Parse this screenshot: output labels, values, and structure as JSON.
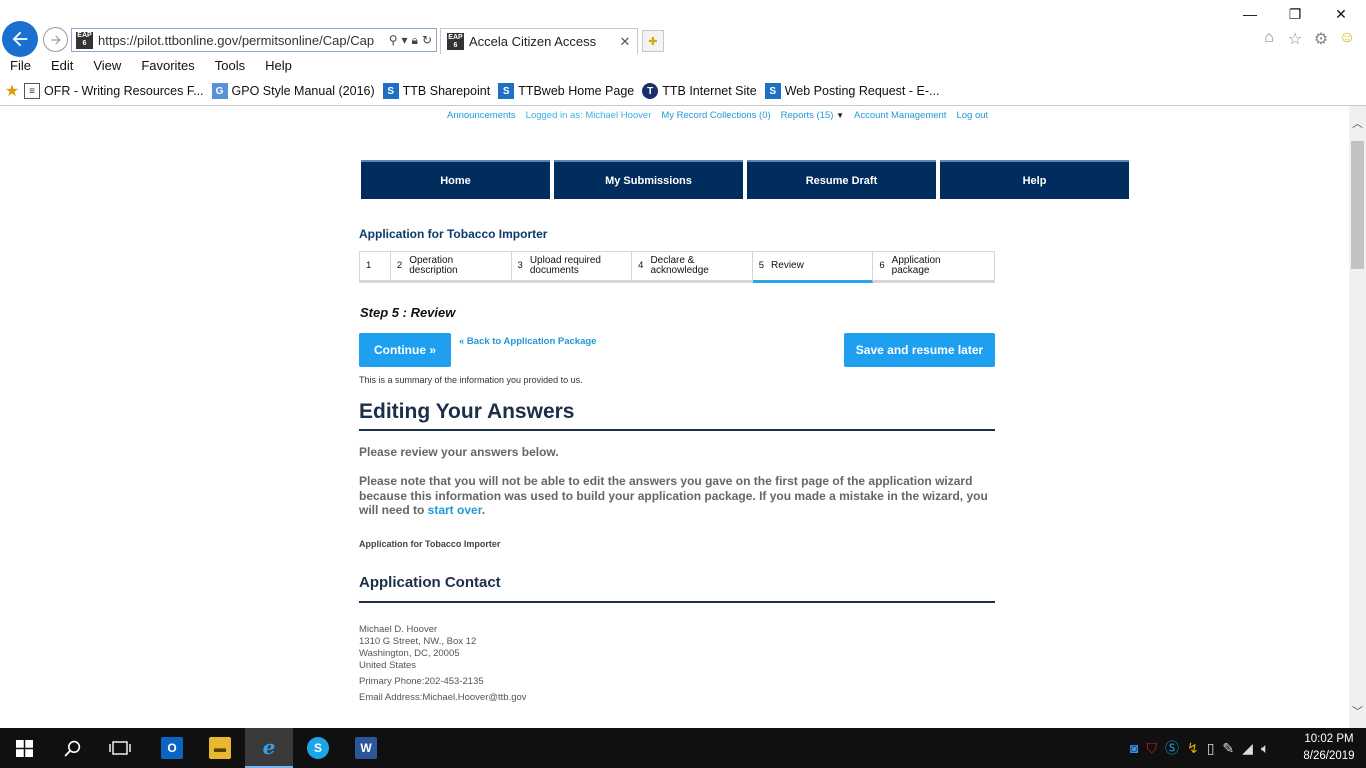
{
  "browser": {
    "address_url": "https://pilot.ttbonline.gov/permitsonline/Cap/Cap",
    "tab_title": "Accela Citizen Access",
    "favicon_label": "EAP 6",
    "menu": [
      "File",
      "Edit",
      "View",
      "Favorites",
      "Tools",
      "Help"
    ],
    "favorites": [
      {
        "label": "OFR - Writing Resources F...",
        "icon": "doc"
      },
      {
        "label": "GPO Style Manual (2016)",
        "icon": "gpo"
      },
      {
        "label": "TTB Sharepoint",
        "icon": "sharepoint"
      },
      {
        "label": "TTBweb Home Page",
        "icon": "sharepoint"
      },
      {
        "label": "TTB Internet Site",
        "icon": "ttb"
      },
      {
        "label": "Web Posting Request - E-...",
        "icon": "sharepoint"
      }
    ]
  },
  "header_links": {
    "announcements": "Announcements",
    "logged_in": "Logged in as: Michael Hoover",
    "collections": "My Record Collections (0)",
    "reports": "Reports (15)",
    "account": "Account Management",
    "logout": "Log out"
  },
  "main_nav": [
    "Home",
    "My Submissions",
    "Resume Draft",
    "Help"
  ],
  "application_title": "Application for Tobacco Importer",
  "steps": [
    {
      "num": "1",
      "label": ""
    },
    {
      "num": "2",
      "label": "Operation description"
    },
    {
      "num": "3",
      "label": "Upload required documents"
    },
    {
      "num": "4",
      "label": "Declare & acknowledge"
    },
    {
      "num": "5",
      "label": "Review"
    },
    {
      "num": "6",
      "label": "Application package"
    }
  ],
  "active_step": 5,
  "step_title": "Step 5 : Review",
  "buttons": {
    "continue": "Continue »",
    "back": "« Back to Application Package",
    "save": "Save and resume later"
  },
  "summary_text": "This is a summary of the information you provided to us.",
  "editing": {
    "heading": "Editing Your Answers",
    "p1": "Please review your answers below.",
    "p2_before": "Please note that you will not be able to edit the answers you gave on the first page of the application wizard because this information was used to build your application package. If you made a mistake in the wizard, you will need to ",
    "p2_link": "start over",
    "p2_after": "."
  },
  "sub_application_title": "Application for Tobacco Importer",
  "contact": {
    "heading": "Application Contact",
    "name": "Michael D. Hoover",
    "street": "1310 G Street, NW., Box 12",
    "city": "Washington, DC, 20005",
    "country": "United States",
    "phone": "Primary Phone:202-453-2135",
    "email": "Email Address:Michael.Hoover@ttb.gov"
  },
  "taskbar": {
    "time": "10:02 PM",
    "date": "8/26/2019"
  },
  "colors": {
    "nav_bg": "#002d5d",
    "accent": "#1e9ff0",
    "link": "#1f9ad6",
    "heading": "#1b2f48"
  }
}
